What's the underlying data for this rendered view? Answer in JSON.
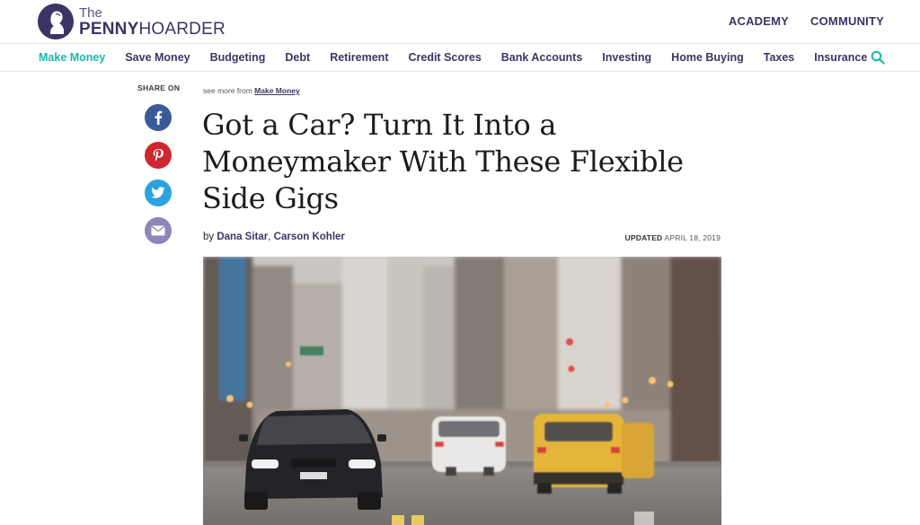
{
  "brand": {
    "logo_the": "The",
    "logo_penny": "PENNY",
    "logo_hoarder": "HOARDER",
    "primary_color": "#3b3566",
    "accent_color": "#18b8a8"
  },
  "top_nav": {
    "items": [
      "ACADEMY",
      "COMMUNITY"
    ]
  },
  "category_nav": {
    "items": [
      "Make Money",
      "Save Money",
      "Budgeting",
      "Debt",
      "Retirement",
      "Credit Scores",
      "Bank Accounts",
      "Investing",
      "Home Buying",
      "Taxes",
      "Insurance"
    ],
    "active": "Make Money",
    "search_icon": "search-icon"
  },
  "share": {
    "label": "SHARE ON",
    "buttons": [
      {
        "icon": "facebook-icon",
        "color": "#3b5a98"
      },
      {
        "icon": "pinterest-icon",
        "color": "#d0262f"
      },
      {
        "icon": "twitter-icon",
        "color": "#2aa3e0"
      },
      {
        "icon": "email-icon",
        "color": "#8e86b8"
      }
    ]
  },
  "article": {
    "see_more_prefix": "see more from",
    "see_more_link": "Make Money",
    "headline": "Got a Car? Turn It Into a Moneymaker With These Flexible Side Gigs",
    "byline_prefix": "by",
    "author_1": "Dana Sitar",
    "author_sep": ",",
    "author_2": "Carson Kohler",
    "updated_label": "UPDATED",
    "updated_date": "APRIL 18, 2019"
  }
}
